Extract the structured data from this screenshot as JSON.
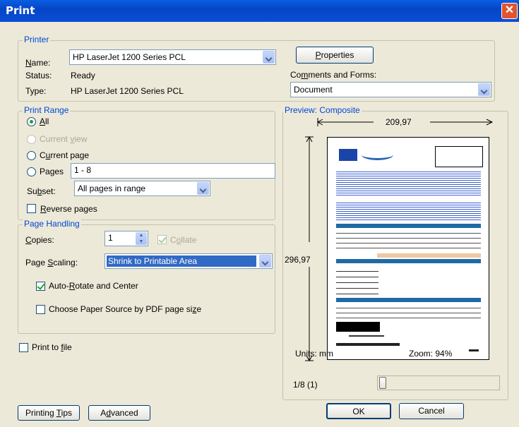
{
  "window": {
    "title": "Print",
    "close_glyph": "✕"
  },
  "printer": {
    "legend": "Printer",
    "name_label_pre": "",
    "name_label_ul": "N",
    "name_label_post": "ame:",
    "name_value": "HP LaserJet 1200 Series PCL",
    "status_label": "Status:",
    "status_value": "Ready",
    "type_label": "Type:",
    "type_value": "HP LaserJet 1200 Series PCL",
    "properties_pre": "",
    "properties_ul": "P",
    "properties_post": "roperties",
    "comments_pre": "Co",
    "comments_ul": "m",
    "comments_post": "ments and Forms:",
    "comments_value": "Document"
  },
  "print_range": {
    "legend": "Print Range",
    "all_pre": "",
    "all_ul": "A",
    "all_post": "ll",
    "current_view_pre": "Current ",
    "current_view_ul": "v",
    "current_view_post": "iew",
    "current_page_pre": "C",
    "current_page_ul": "u",
    "current_page_post": "rrent page",
    "pages_pre": "Pa",
    "pages_ul": "g",
    "pages_post": "es",
    "pages_value": "1 - 8",
    "subset_pre": "Su",
    "subset_ul": "b",
    "subset_post": "set:",
    "subset_value": "All pages in range",
    "reverse_pre": "",
    "reverse_ul": "R",
    "reverse_post": "everse pages"
  },
  "page_handling": {
    "legend": "Page Handling",
    "copies_pre": "",
    "copies_ul": "C",
    "copies_post": "opies:",
    "copies_value": "1",
    "collate_pre": "C",
    "collate_ul": "o",
    "collate_post": "llate",
    "scaling_pre": "Page ",
    "scaling_ul": "S",
    "scaling_post": "caling:",
    "scaling_value": "Shrink to Printable Area",
    "autorotate_pre": "Auto-",
    "autorotate_ul": "R",
    "autorotate_post": "otate and Center",
    "paper_source_pre": "Choose Paper Source by PDF page si",
    "paper_source_ul": "z",
    "paper_source_post": "e"
  },
  "print_to_file": {
    "pre": "Print to ",
    "ul": "f",
    "post": "ile"
  },
  "preview": {
    "legend": "Preview: Composite",
    "width_value": "209,97",
    "height_value": "296,97",
    "units": "Units: mm",
    "zoom": "Zoom:  94%",
    "page_indicator": "1/8 (1)",
    "slider_position": 0.0
  },
  "footer": {
    "tips_pre": "Printing ",
    "tips_ul": "T",
    "tips_post": "ips",
    "advanced_pre": "A",
    "advanced_ul": "d",
    "advanced_post": "vanced",
    "ok": "OK",
    "cancel": "Cancel"
  },
  "colors": {
    "title_bar": "#0546c7",
    "legend": "#0046d5",
    "highlight": "#316ac5",
    "dialog": "#ece9d8"
  }
}
